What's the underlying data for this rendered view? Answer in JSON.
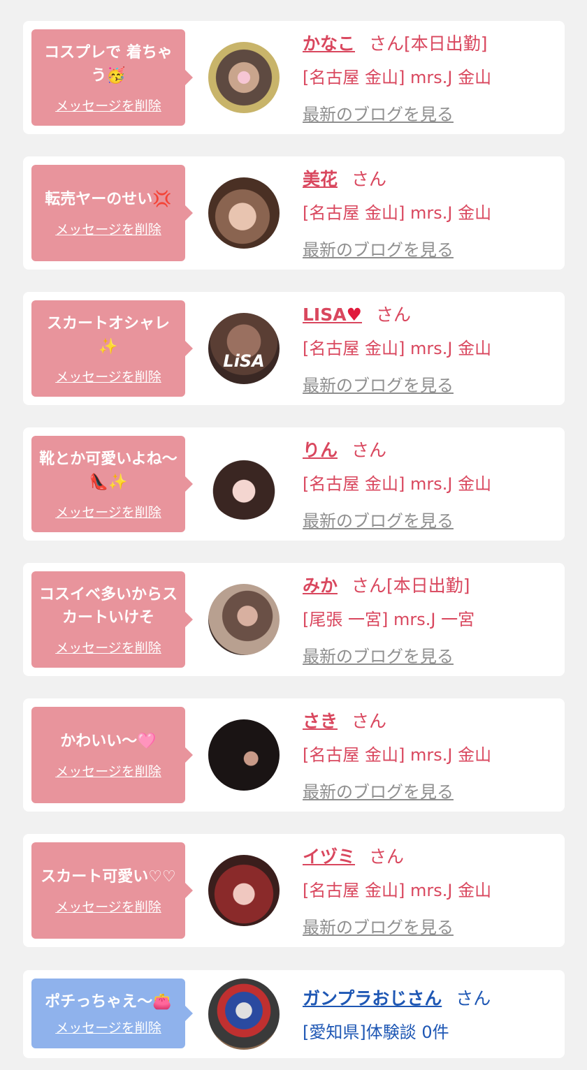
{
  "delete_label": "メッセージを削除",
  "san_label": "さん",
  "blog_label": "最新のブログを見る",
  "colors": {
    "pink_bubble": "#e8949c",
    "blue_bubble": "#8fb2ec",
    "name_pink": "#d9475e",
    "name_blue": "#1e57b4"
  },
  "cards": [
    {
      "message": "コスプレで 着ちゃう🥳",
      "name": "かなこ",
      "status": "[本日出勤]",
      "shop": "[名古屋 金山] mrs.J 金山",
      "avatar_icon": "profile-photo"
    },
    {
      "message": "転売ヤーのせい💢",
      "name": "美花",
      "status": "",
      "shop": "[名古屋 金山] mrs.J 金山",
      "avatar_icon": "profile-photo"
    },
    {
      "message": "スカートオシャレ✨",
      "name": "LISA",
      "status": "",
      "shop": "[名古屋 金山] mrs.J 金山",
      "avatar_icon": "profile-photo",
      "avatar_text": "LiSA"
    },
    {
      "message": "靴とか可愛いよね〜👠✨",
      "name": "りん",
      "status": "",
      "shop": "[名古屋 金山] mrs.J 金山",
      "avatar_icon": "profile-photo"
    },
    {
      "message": "コスイベ多いからスカートいけそ",
      "name": "みか",
      "status": "[本日出勤]",
      "shop": "[尾張 一宮] mrs.J 一宮",
      "avatar_icon": "profile-photo"
    },
    {
      "message": "かわいい〜🩷",
      "name": "さき",
      "status": "",
      "shop": "[名古屋 金山] mrs.J 金山",
      "avatar_icon": "profile-photo"
    },
    {
      "message": "スカート可愛い♡♡",
      "name": "イヅミ",
      "status": "",
      "shop": "[名古屋 金山] mrs.J 金山",
      "avatar_icon": "profile-photo"
    },
    {
      "message": "ポチっちゃえ〜👛",
      "name": "ガンプラおじさん",
      "status": "",
      "shop": "[愛知県]体験談 0件",
      "avatar_icon": "gundam-photo"
    }
  ]
}
